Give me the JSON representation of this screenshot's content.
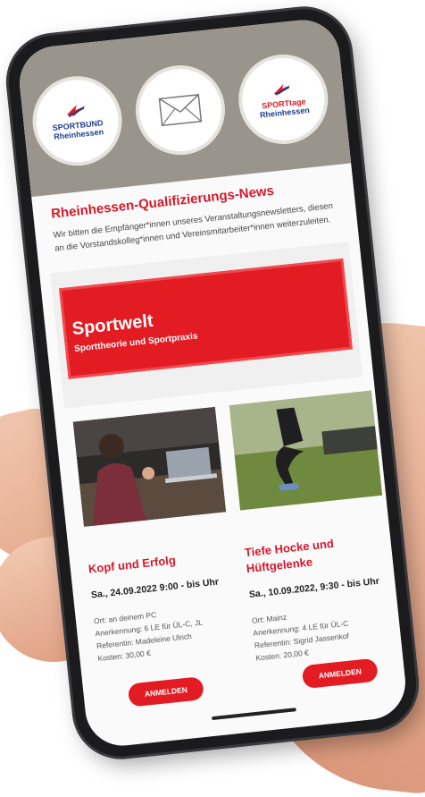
{
  "header": {
    "logos": [
      {
        "name": "sportbund-logo",
        "lines": [
          "SPORTBUND",
          "Rheinhessen"
        ]
      },
      {
        "name": "mail-logo",
        "lines": []
      },
      {
        "name": "sporttage-logo",
        "lines": [
          "SPORTtage",
          "Rheinhessen"
        ]
      }
    ]
  },
  "intro": {
    "title": "Rheinhessen-Qualifizierungs-News",
    "text": "Wir bitten die Empfänger*innen unseres Veranstaltungsnewsletters, diesen an die Vorstandskolleg*innen und Vereinsmitarbeiter*innen weiterzuleiten."
  },
  "banner": {
    "title": "Sportwelt",
    "subtitle": "Sporttheorie und Sportpraxis"
  },
  "cards": [
    {
      "title": "Kopf und Erfolg",
      "date": "Sa., 24.09.2022 9:00 - bis Uhr",
      "ort": "Ort: an deinem PC",
      "anerkennung": "Anerkennung: 6 LE für ÜL-C, JL",
      "referentin": "Referentin: Madeleine Ulrich",
      "kosten": "Kosten: 30,00 €",
      "button": "ANMELDEN"
    },
    {
      "title": "Tiefe Hocke und Hüftgelenke",
      "date": "Sa., 10.09.2022, 9:30 - bis Uhr",
      "ort": "Ort: Mainz",
      "anerkennung": "Anerkennung: 4 LE für ÜL-C",
      "referentin": "Referentin: Sigrid Jassenkof",
      "kosten": "Kosten: 20,00 €",
      "button": "ANMELDEN"
    }
  ]
}
